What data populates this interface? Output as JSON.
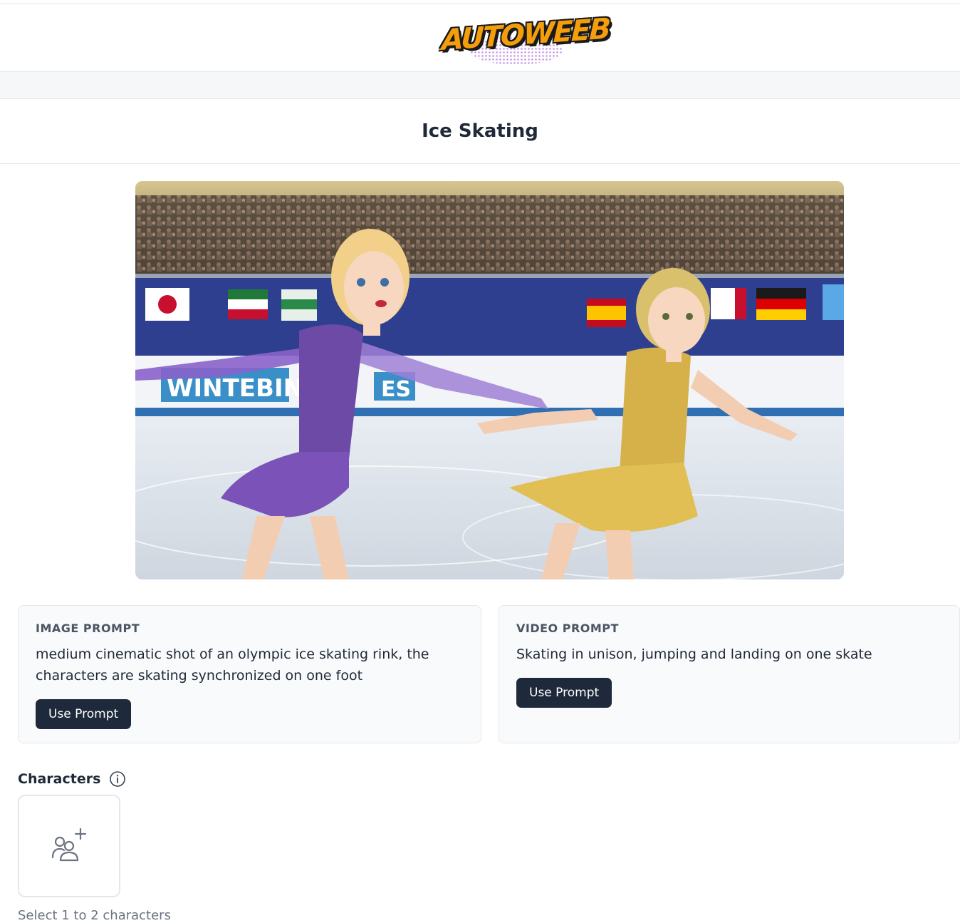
{
  "header": {
    "logo_text": "AUTOWEEB"
  },
  "page": {
    "title": "Ice Skating"
  },
  "hero": {
    "banner_text": "WINTEBIN",
    "banner_text_right": "ES"
  },
  "image_prompt": {
    "label": "IMAGE PROMPT",
    "text": "medium cinematic shot of an olympic ice skating rink, the characters are skating synchronized on one foot",
    "button": "Use Prompt"
  },
  "video_prompt": {
    "label": "VIDEO PROMPT",
    "text": "Skating in unison, jumping and landing on one skate",
    "button": "Use Prompt"
  },
  "characters": {
    "title": "Characters",
    "helper": "Select 1 to 2 characters"
  },
  "icons": {
    "info": "info-icon",
    "add_character": "add-user-group-icon"
  },
  "colors": {
    "button_bg": "#1e293b",
    "card_bg": "#f9fafb",
    "logo_orange": "#f59e0b"
  }
}
